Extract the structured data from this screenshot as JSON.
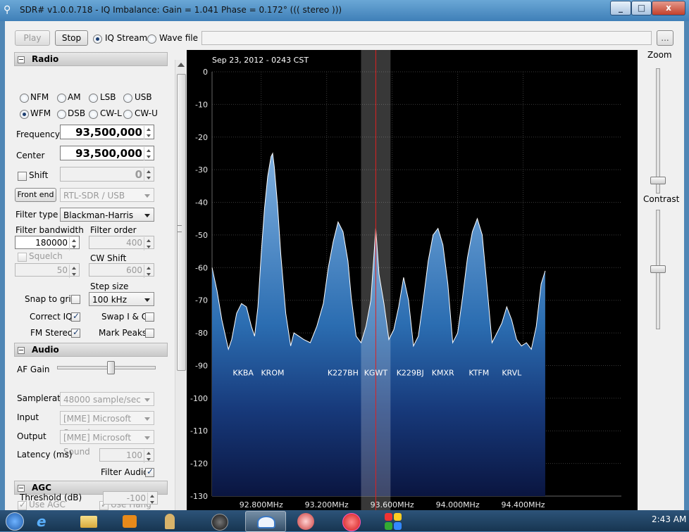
{
  "window": {
    "title": "SDR# v1.0.0.718 - IQ Imbalance: Gain = 1.041 Phase = 0.172° ((( stereo )))",
    "controls": [
      "_",
      "□",
      "x"
    ]
  },
  "toolbar": {
    "play_label": "Play",
    "stop_label": "Stop",
    "source_options": [
      {
        "label": "IQ Stream",
        "selected": true
      },
      {
        "label": "Wave file",
        "selected": false
      }
    ],
    "file_path": "",
    "browse_label": "..."
  },
  "radio": {
    "header": "Radio",
    "modes": [
      {
        "label": "NFM",
        "selected": false
      },
      {
        "label": "AM",
        "selected": false
      },
      {
        "label": "LSB",
        "selected": false
      },
      {
        "label": "USB",
        "selected": false
      },
      {
        "label": "WFM",
        "selected": true
      },
      {
        "label": "DSB",
        "selected": false
      },
      {
        "label": "CW-L",
        "selected": false
      },
      {
        "label": "CW-U",
        "selected": false
      }
    ],
    "frequency_label": "Frequency",
    "frequency_value": "93,500,000",
    "center_label": "Center",
    "center_value": "93,500,000",
    "shift_label": "Shift",
    "shift_checked": false,
    "shift_value": "0",
    "front_end_label": "Front end",
    "front_end_value": "RTL-SDR / USB",
    "filter_type_label": "Filter type",
    "filter_type_value": "Blackman-Harris",
    "filter_bandwidth_label": "Filter bandwidth",
    "filter_bandwidth_value": "180000",
    "filter_order_label": "Filter order",
    "filter_order_value": "400",
    "squelch_label": "Squelch",
    "squelch_value": "50",
    "cw_shift_label": "CW Shift",
    "cw_shift_value": "600",
    "step_size_label": "Step size",
    "step_size_value": "100 kHz",
    "snap_to_grid_label": "Snap to grid",
    "snap_to_grid_checked": false,
    "correct_iq_label": "Correct IQ",
    "correct_iq_checked": true,
    "swap_iq_label": "Swap I & Q",
    "swap_iq_checked": false,
    "fm_stereo_label": "FM Stereo",
    "fm_stereo_checked": true,
    "mark_peaks_label": "Mark Peaks",
    "mark_peaks_checked": false
  },
  "audio": {
    "header": "Audio",
    "af_gain_label": "AF Gain",
    "af_gain_level": 0.55,
    "samplerate_label": "Samplerate",
    "samplerate_value": "48000 sample/sec",
    "input_label": "Input",
    "input_value": "[MME] Microsoft Sound",
    "output_label": "Output",
    "output_value": "[MME] Microsoft Sound",
    "latency_label": "Latency (ms)",
    "latency_value": "100",
    "filter_audio_label": "Filter Audio",
    "filter_audio_checked": true
  },
  "agc": {
    "header": "AGC",
    "use_agc_label": "Use AGC",
    "use_agc_checked": true,
    "use_hang_label": "Use Hang",
    "use_hang_checked": true,
    "threshold_label": "Threshold (dB)",
    "threshold_value": "-100"
  },
  "right_panel": {
    "zoom_label": "Zoom",
    "zoom_level": 0.93,
    "contrast_label": "Contrast",
    "contrast_level": 0.5
  },
  "taskbar": {
    "clock": "2:43 AM",
    "icons": [
      "start-orb-icon",
      "internet-explorer-icon",
      "file-explorer-icon",
      "media-player-icon",
      "user-figure-icon",
      "camera-icon",
      "sdr-app-icon",
      "network-monitor-icon",
      "record-icon",
      "app-grid-icon"
    ]
  },
  "colors": {
    "spectrum_fill": "#2b6db1",
    "spectrum_line": "#ffffff",
    "filter_band": "#404040",
    "tuning_line": "#e02020",
    "window_frame": "#4f86b5"
  },
  "chart_data": {
    "type": "area",
    "title": "Sep 23, 2012 - 0243 CST",
    "xlabel": "",
    "ylabel": "",
    "xlim": [
      92.5,
      95.0
    ],
    "ylim": [
      -130,
      0
    ],
    "yticks": [
      0,
      -10,
      -20,
      -30,
      -40,
      -50,
      -60,
      -70,
      -80,
      -90,
      -100,
      -110,
      -120,
      -130
    ],
    "xticks": [
      {
        "value": 92.8,
        "label": "92.800MHz"
      },
      {
        "value": 93.2,
        "label": "93.200MHz"
      },
      {
        "value": 93.6,
        "label": "93.600MHz"
      },
      {
        "value": 94.0,
        "label": "94.000MHz"
      },
      {
        "value": 94.4,
        "label": "94.400MHz"
      }
    ],
    "grid": true,
    "tuned_frequency_mhz": 93.5,
    "filter_band_mhz": [
      93.41,
      93.59
    ],
    "stations": [
      {
        "label": "KKBA",
        "freq": 92.69
      },
      {
        "label": "KROM",
        "freq": 92.87
      },
      {
        "label": "K227BH",
        "freq": 93.3
      },
      {
        "label": "KGWT",
        "freq": 93.5
      },
      {
        "label": "K229BJ",
        "freq": 93.71
      },
      {
        "label": "KMXR",
        "freq": 93.91
      },
      {
        "label": "KTFM",
        "freq": 94.13
      },
      {
        "label": "KRVL",
        "freq": 94.33
      }
    ],
    "series": [
      {
        "x": [
          92.5,
          92.53,
          92.56,
          92.6,
          92.62,
          92.65,
          92.68,
          92.71,
          92.74,
          92.76,
          92.78,
          92.8,
          92.82,
          92.84,
          92.86,
          92.87,
          92.88,
          92.9,
          92.92,
          92.95,
          92.98,
          93.0,
          93.03,
          93.06,
          93.1,
          93.14,
          93.18,
          93.21,
          93.24,
          93.27,
          93.3,
          93.33,
          93.35,
          93.38,
          93.41,
          93.44,
          93.47,
          93.5,
          93.52,
          93.55,
          93.58,
          93.61,
          93.64,
          93.67,
          93.7,
          93.73,
          93.76,
          93.79,
          93.82,
          93.85,
          93.88,
          93.91,
          93.94,
          93.97,
          94.0,
          94.03,
          94.06,
          94.09,
          94.12,
          94.15,
          94.18,
          94.21,
          94.24,
          94.27,
          94.3,
          94.33,
          94.36,
          94.39,
          94.42,
          94.45,
          94.48,
          94.51,
          94.535
        ],
        "values": [
          -60,
          -67,
          -76,
          -85,
          -82,
          -74,
          -71,
          -72,
          -78,
          -81,
          -72,
          -56,
          -42,
          -32,
          -26,
          -25,
          -29,
          -41,
          -56,
          -74,
          -84,
          -80,
          -81,
          -82,
          -83,
          -78,
          -71,
          -60,
          -52,
          -46,
          -49,
          -58,
          -69,
          -81,
          -83,
          -78,
          -70,
          -48,
          -62,
          -71,
          -82,
          -79,
          -72,
          -63,
          -70,
          -84,
          -81,
          -70,
          -58,
          -50,
          -48,
          -53,
          -65,
          -83,
          -80,
          -69,
          -57,
          -49,
          -45,
          -50,
          -66,
          -83,
          -80,
          -77,
          -72,
          -76,
          -82,
          -84,
          -83,
          -85,
          -78,
          -65,
          -61
        ]
      }
    ]
  }
}
